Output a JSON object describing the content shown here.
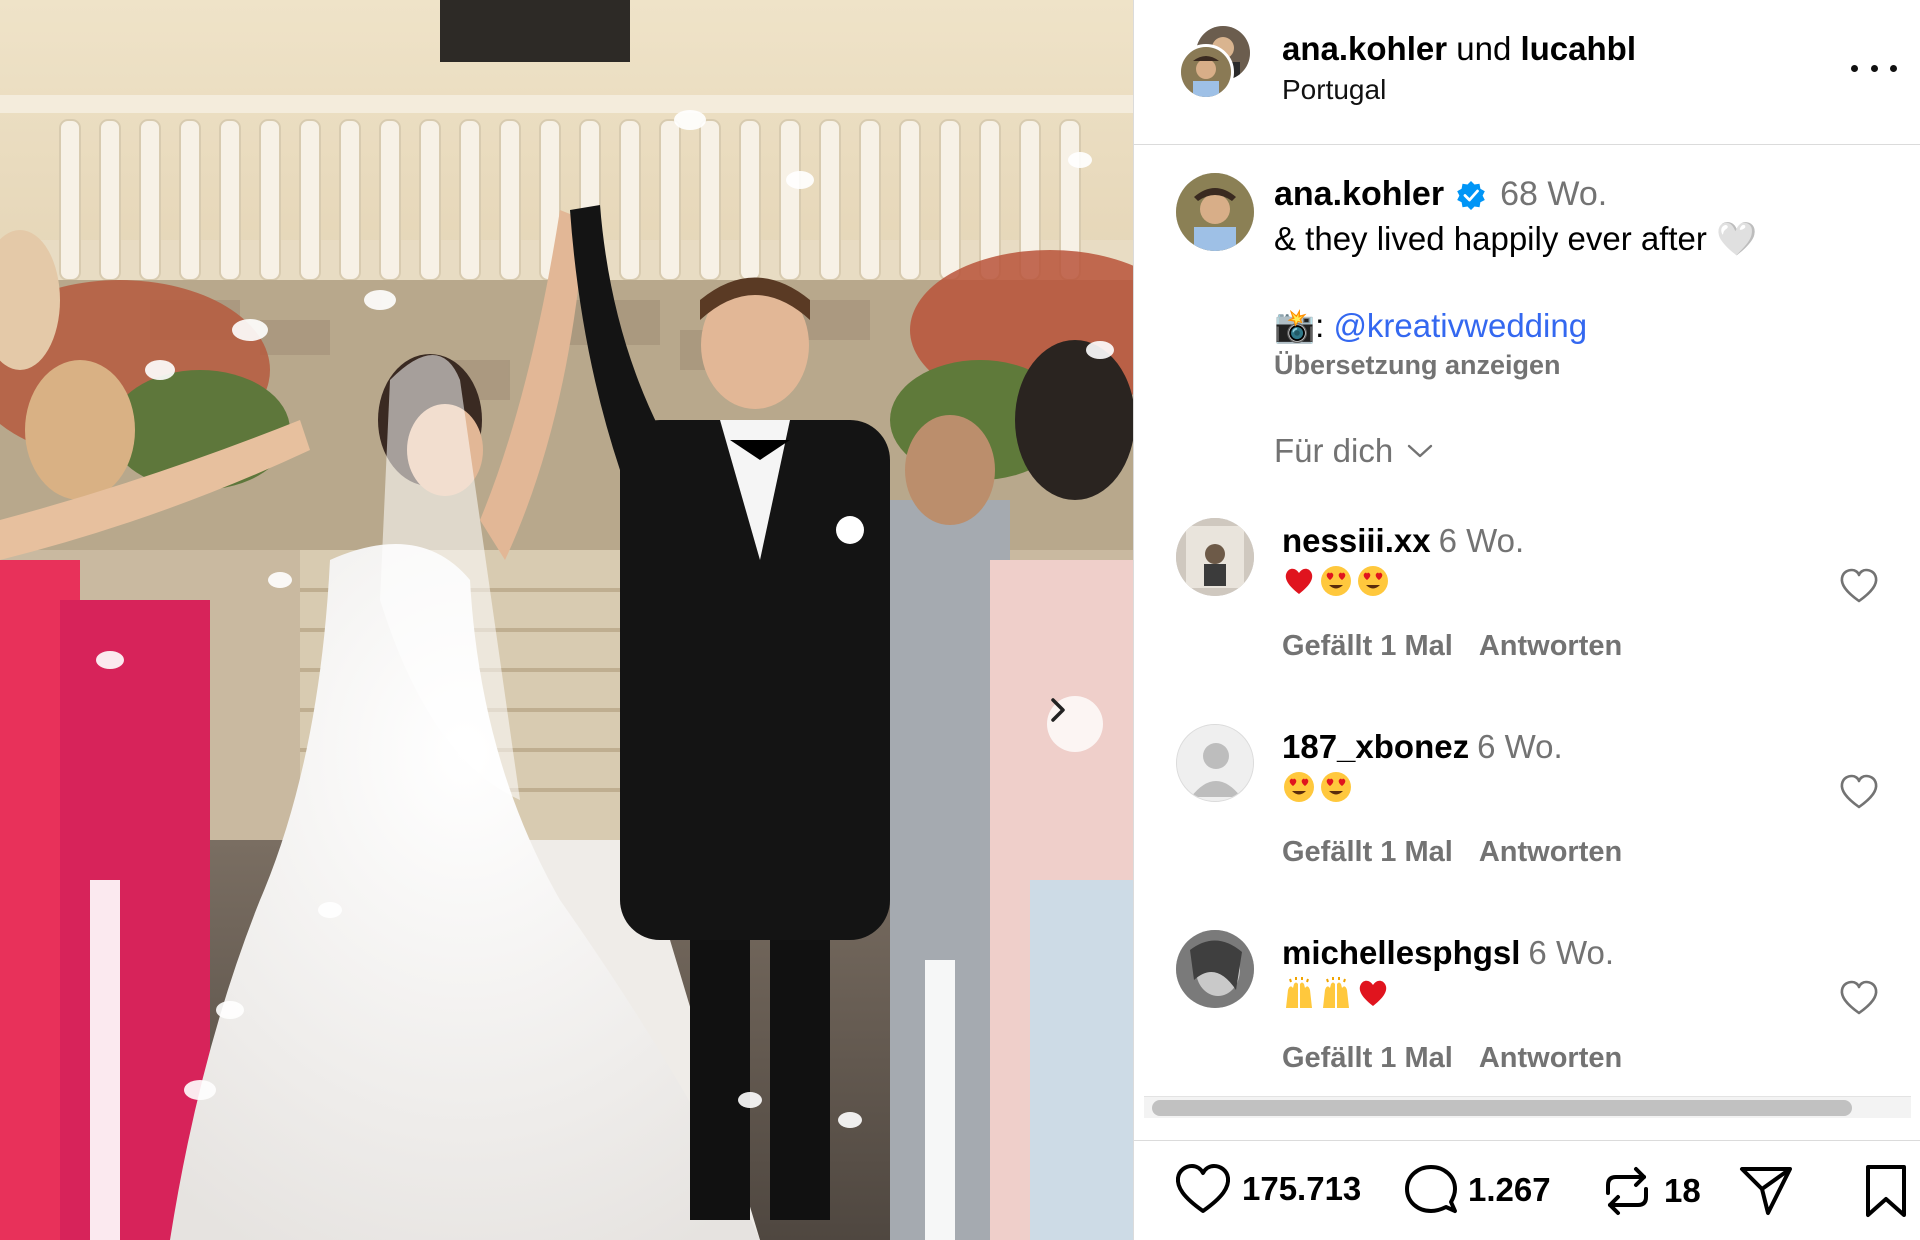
{
  "post_header": {
    "user_a": "ana.kohler",
    "connector": "und",
    "user_b": "lucahbl",
    "location": "Portugal",
    "more_icon": "more-options-icon"
  },
  "caption": {
    "username": "ana.kohler",
    "verified": true,
    "time": "68 Wo.",
    "text": "& they lived happily ever after",
    "heart": "🤍",
    "camera_emoji": "📸",
    "credit_sep": ":",
    "mention": "@kreativwedding",
    "translate_label": "Übersetzung anzeigen"
  },
  "comment_filter": {
    "label": "Für dich",
    "icon": "chevron-down-icon"
  },
  "comments": [
    {
      "username": "nessiii.xx",
      "time": "6 Wo.",
      "emojis": [
        "heart-red",
        "heart-eyes",
        "heart-eyes"
      ],
      "likes_label": "Gefällt 1 Mal",
      "reply_label": "Antworten"
    },
    {
      "username": "187_xbonez",
      "time": "6 Wo.",
      "emojis": [
        "heart-eyes",
        "heart-eyes"
      ],
      "likes_label": "Gefällt 1 Mal",
      "reply_label": "Antworten"
    },
    {
      "username": "michellesphgsl",
      "time": "6 Wo.",
      "emojis": [
        "raised-hands",
        "raised-hands",
        "heart-red"
      ],
      "likes_label": "Gefällt 1 Mal",
      "reply_label": "Antworten"
    }
  ],
  "actions": {
    "likes": "175.713",
    "comments": "1.267",
    "reposts": "18",
    "icons": [
      "heart-icon",
      "comment-icon",
      "repost-icon",
      "share-icon",
      "bookmark-icon"
    ]
  },
  "photo": {
    "next_icon": "chevron-right-icon"
  },
  "colors": {
    "link": "#3468f0",
    "muted": "#737373",
    "border": "#dbdbdb",
    "verified": "#0095f6",
    "heart_red": "#e0141e",
    "emoji_yellow": "#ffc83d"
  }
}
